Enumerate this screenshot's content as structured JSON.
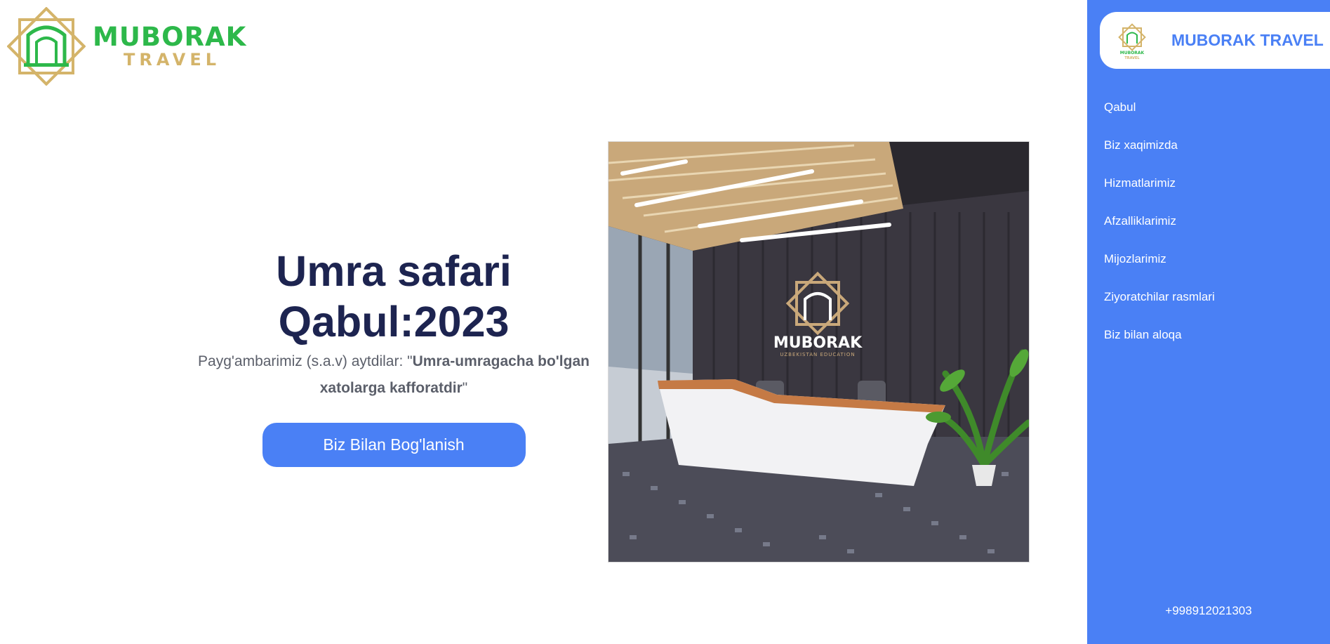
{
  "logo": {
    "name_line1": "MUBORAK",
    "name_line2": "TRAVEL"
  },
  "hero": {
    "title_line1": "Umra safari",
    "title_line2": "Qabul:2023",
    "quote_prefix": "Payg'ambarimiz (s.a.v) aytdilar: \"",
    "quote_bold": "Umra-umragacha bo'lgan xatolarga kafforatdir",
    "quote_suffix": "\"",
    "cta_label": "Biz Bilan Bog'lanish"
  },
  "hero_image": {
    "sign_text": "MUBORAK",
    "sign_subtext": "UZBEKISTAN EDUCATION"
  },
  "sidebar": {
    "brand_name": "MUBORAK TRAVEL",
    "mini_logo_text": "MUBORAK TRAVEL",
    "nav": [
      {
        "label": "Qabul"
      },
      {
        "label": "Biz xaqimizda"
      },
      {
        "label": "Hizmatlarimiz"
      },
      {
        "label": "Afzalliklarimiz"
      },
      {
        "label": "Mijozlarimiz"
      },
      {
        "label": "Ziyoratchilar rasmlari"
      },
      {
        "label": "Biz bilan aloqa"
      }
    ],
    "phone": "+998912021303"
  },
  "colors": {
    "accent": "#4a80f5",
    "title": "#1d2450",
    "logo_green": "#2db84a",
    "logo_gold": "#d4b46a"
  },
  "icons": [
    "muborak-logo-icon",
    "star-emblem-icon"
  ]
}
